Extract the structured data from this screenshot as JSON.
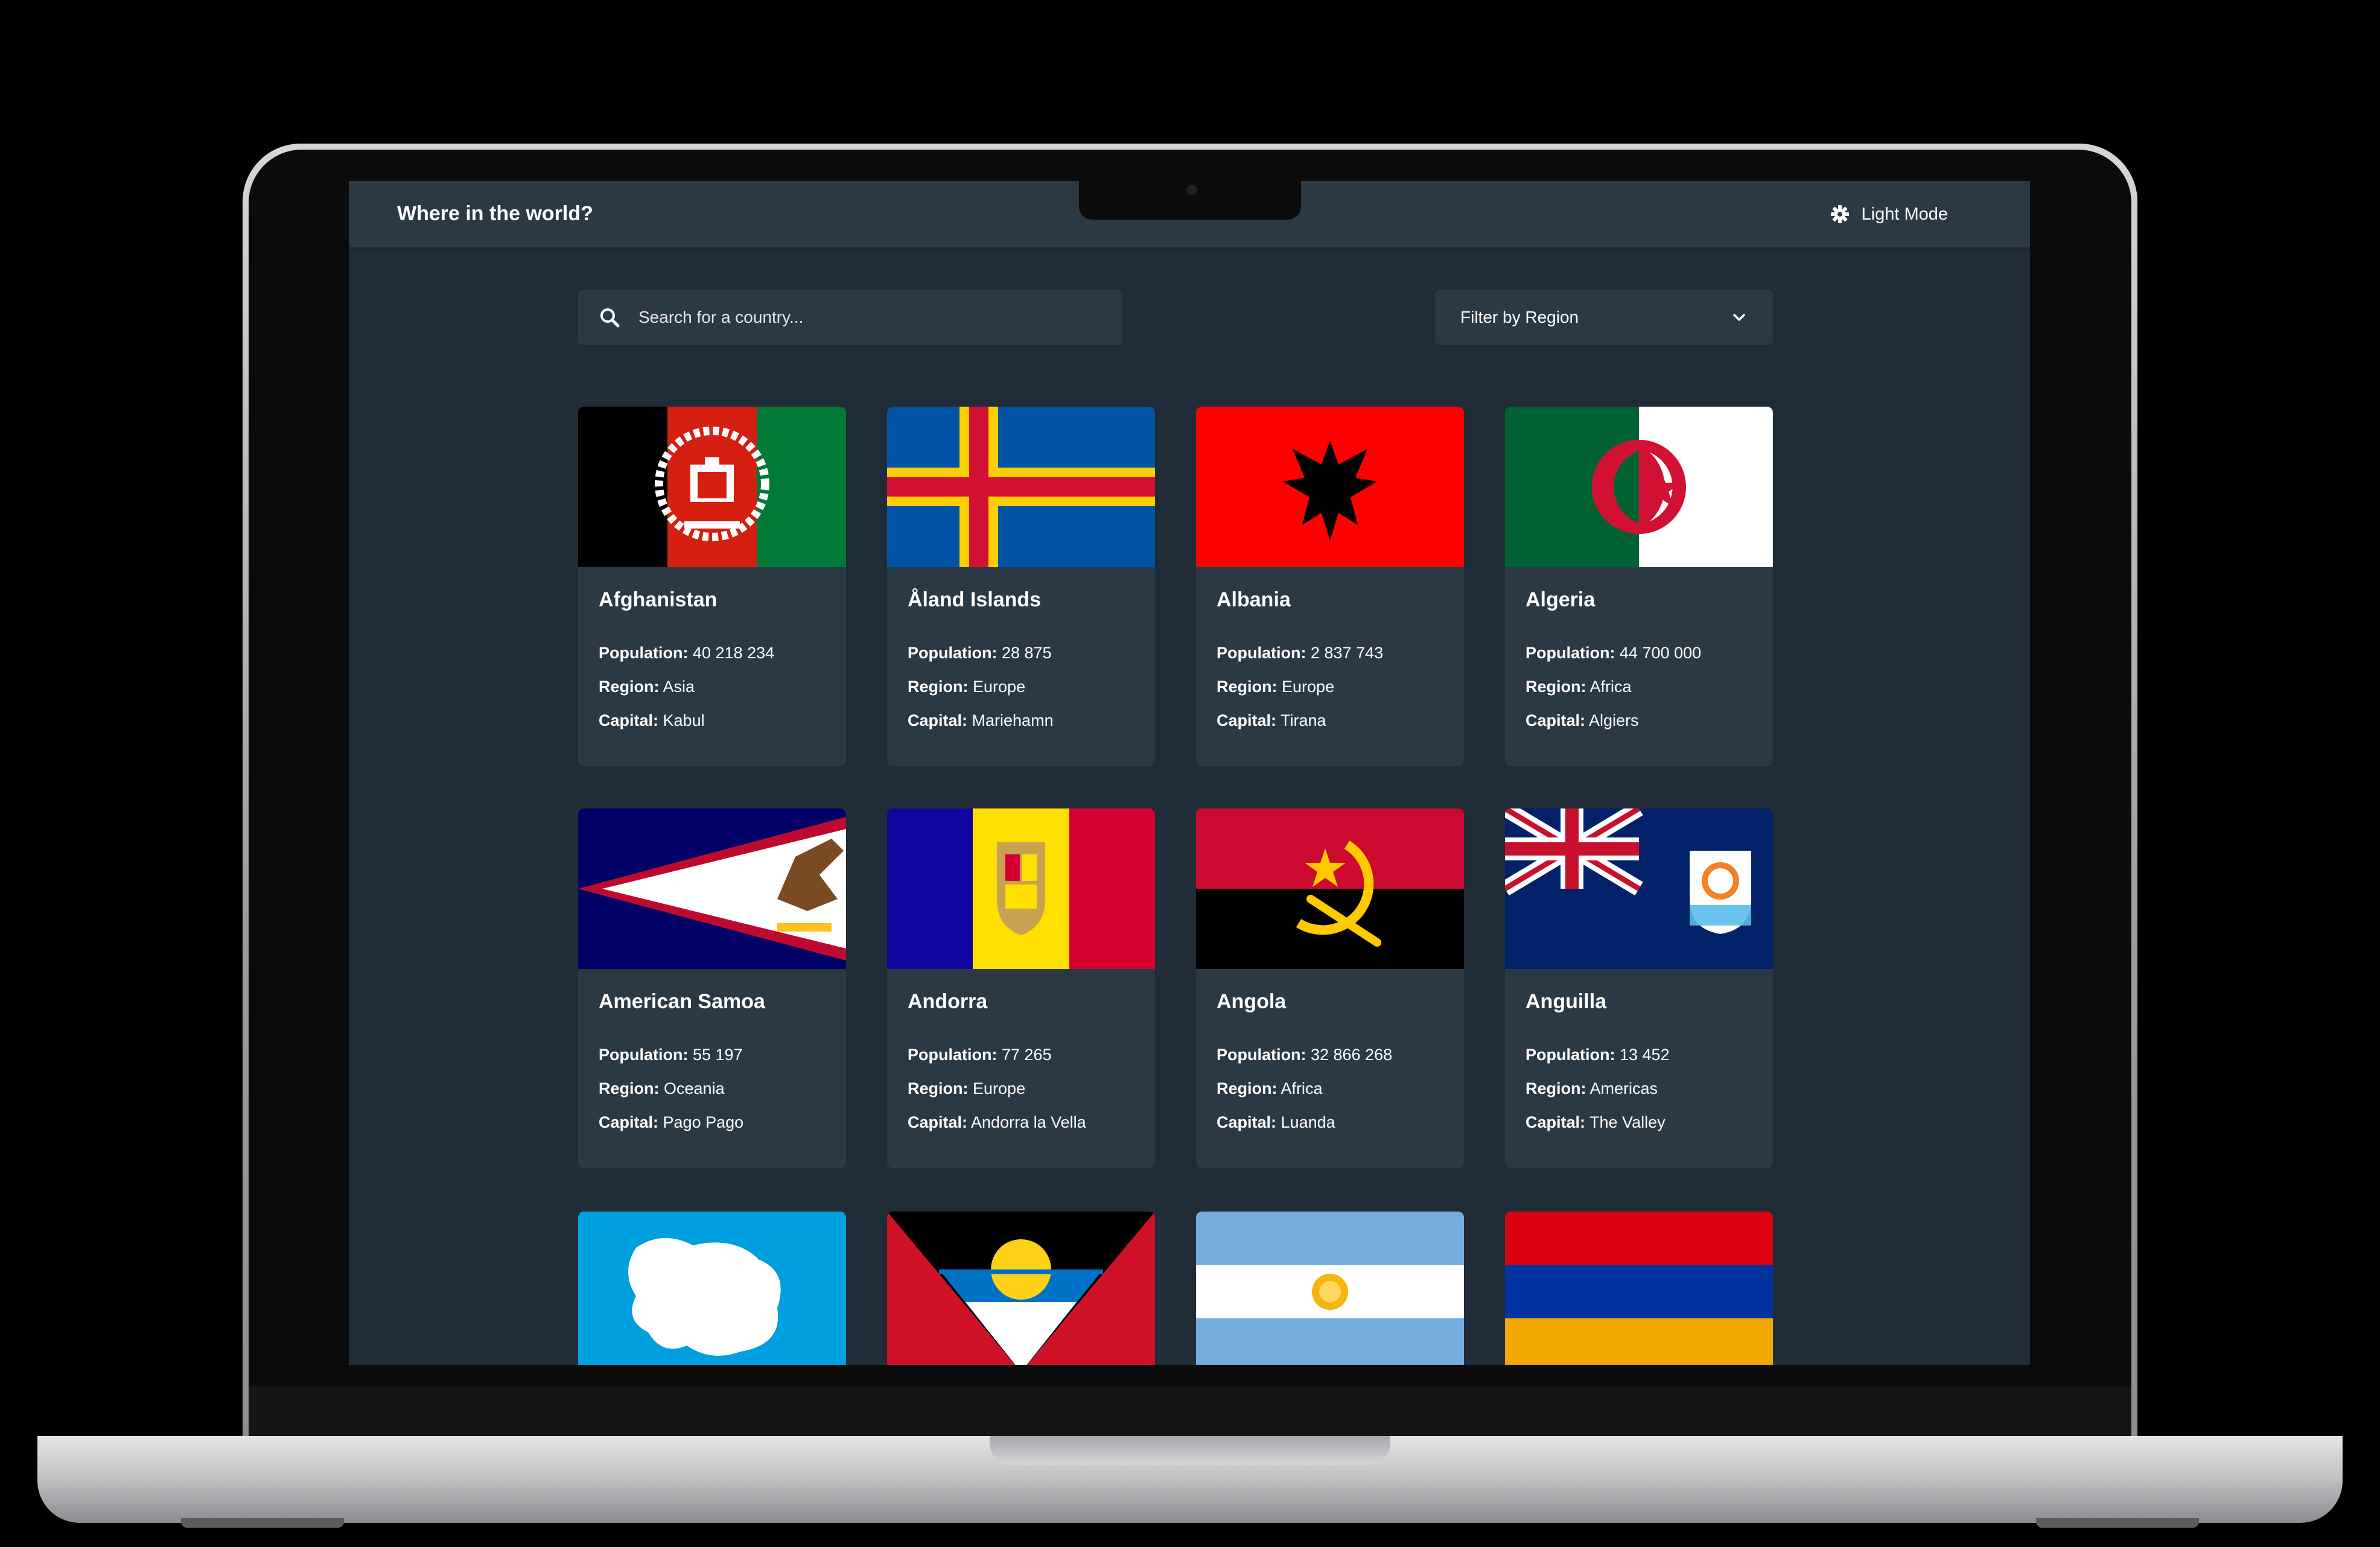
{
  "app": {
    "title": "Where in the world?",
    "mode_label": "Light Mode",
    "theme": {
      "background": "#202c37",
      "element": "#2b3945",
      "text": "#ffffff"
    }
  },
  "search": {
    "placeholder": "Search for a country..."
  },
  "filter": {
    "label": "Filter by Region"
  },
  "labels": {
    "population": "Population:",
    "region": "Region:",
    "capital": "Capital:"
  },
  "countries": [
    {
      "name": "Afghanistan",
      "population": "40 218 234",
      "region": "Asia",
      "capital": "Kabul",
      "flag": "afghanistan-flag"
    },
    {
      "name": "Åland Islands",
      "population": "28 875",
      "region": "Europe",
      "capital": "Mariehamn",
      "flag": "aland-flag"
    },
    {
      "name": "Albania",
      "population": "2 837 743",
      "region": "Europe",
      "capital": "Tirana",
      "flag": "albania-flag"
    },
    {
      "name": "Algeria",
      "population": "44 700 000",
      "region": "Africa",
      "capital": "Algiers",
      "flag": "algeria-flag"
    },
    {
      "name": "American Samoa",
      "population": "55 197",
      "region": "Oceania",
      "capital": "Pago Pago",
      "flag": "american-samoa-flag"
    },
    {
      "name": "Andorra",
      "population": "77 265",
      "region": "Europe",
      "capital": "Andorra la Vella",
      "flag": "andorra-flag"
    },
    {
      "name": "Angola",
      "population": "32 866 268",
      "region": "Africa",
      "capital": "Luanda",
      "flag": "angola-flag"
    },
    {
      "name": "Anguilla",
      "population": "13 452",
      "region": "Americas",
      "capital": "The Valley",
      "flag": "anguilla-flag"
    },
    {
      "flag": "antarctica-flag"
    },
    {
      "flag": "antigua-and-barbuda-flag"
    },
    {
      "flag": "argentina-flag"
    },
    {
      "flag": "armenia-flag"
    }
  ]
}
